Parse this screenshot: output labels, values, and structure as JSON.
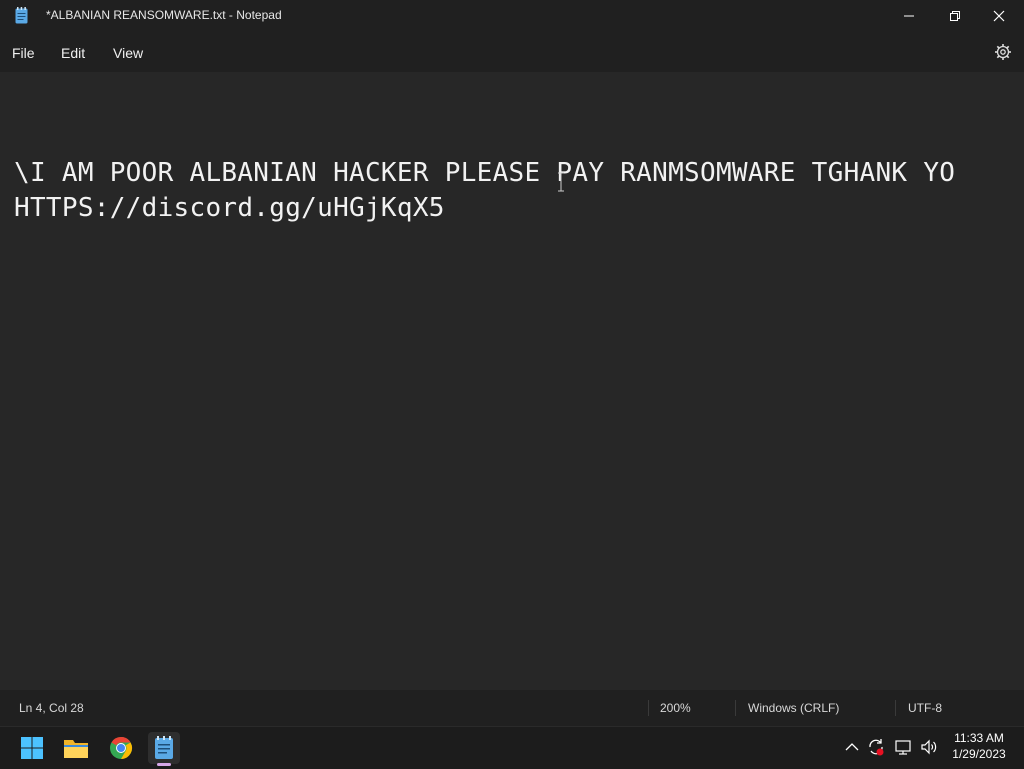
{
  "window": {
    "title": "*ALBANIAN REANSOMWARE.txt - Notepad",
    "app_icon": "notepad-icon",
    "controls": [
      "minimize-icon",
      "maximize-icon",
      "close-icon"
    ]
  },
  "menu": {
    "items": [
      {
        "label": "File"
      },
      {
        "label": "Edit"
      },
      {
        "label": "View"
      }
    ],
    "settings_icon": "gear-icon"
  },
  "editor": {
    "lines": [
      "",
      "",
      "\\I AM POOR ALBANIAN HACKER PLEASE PAY RANMSOMWARE TGHANK YO",
      "HTTPS://discord.gg/uHGjKqX5"
    ]
  },
  "status": {
    "position": "Ln 4, Col 28",
    "zoom": "200%",
    "line_ending": "Windows (CRLF)",
    "encoding": "UTF-8"
  },
  "taskbar": {
    "apps": [
      "windows-start-icon",
      "file-explorer-icon",
      "chrome-icon",
      "notepad-icon"
    ],
    "tray": [
      "chevron-up-icon",
      "sync-icon",
      "network-icon",
      "volume-icon"
    ],
    "time": "11:33 AM",
    "date": "1/29/2023"
  },
  "colors": {
    "background": "#272727",
    "chrome": "#202020",
    "text": "#f2f2f2"
  }
}
